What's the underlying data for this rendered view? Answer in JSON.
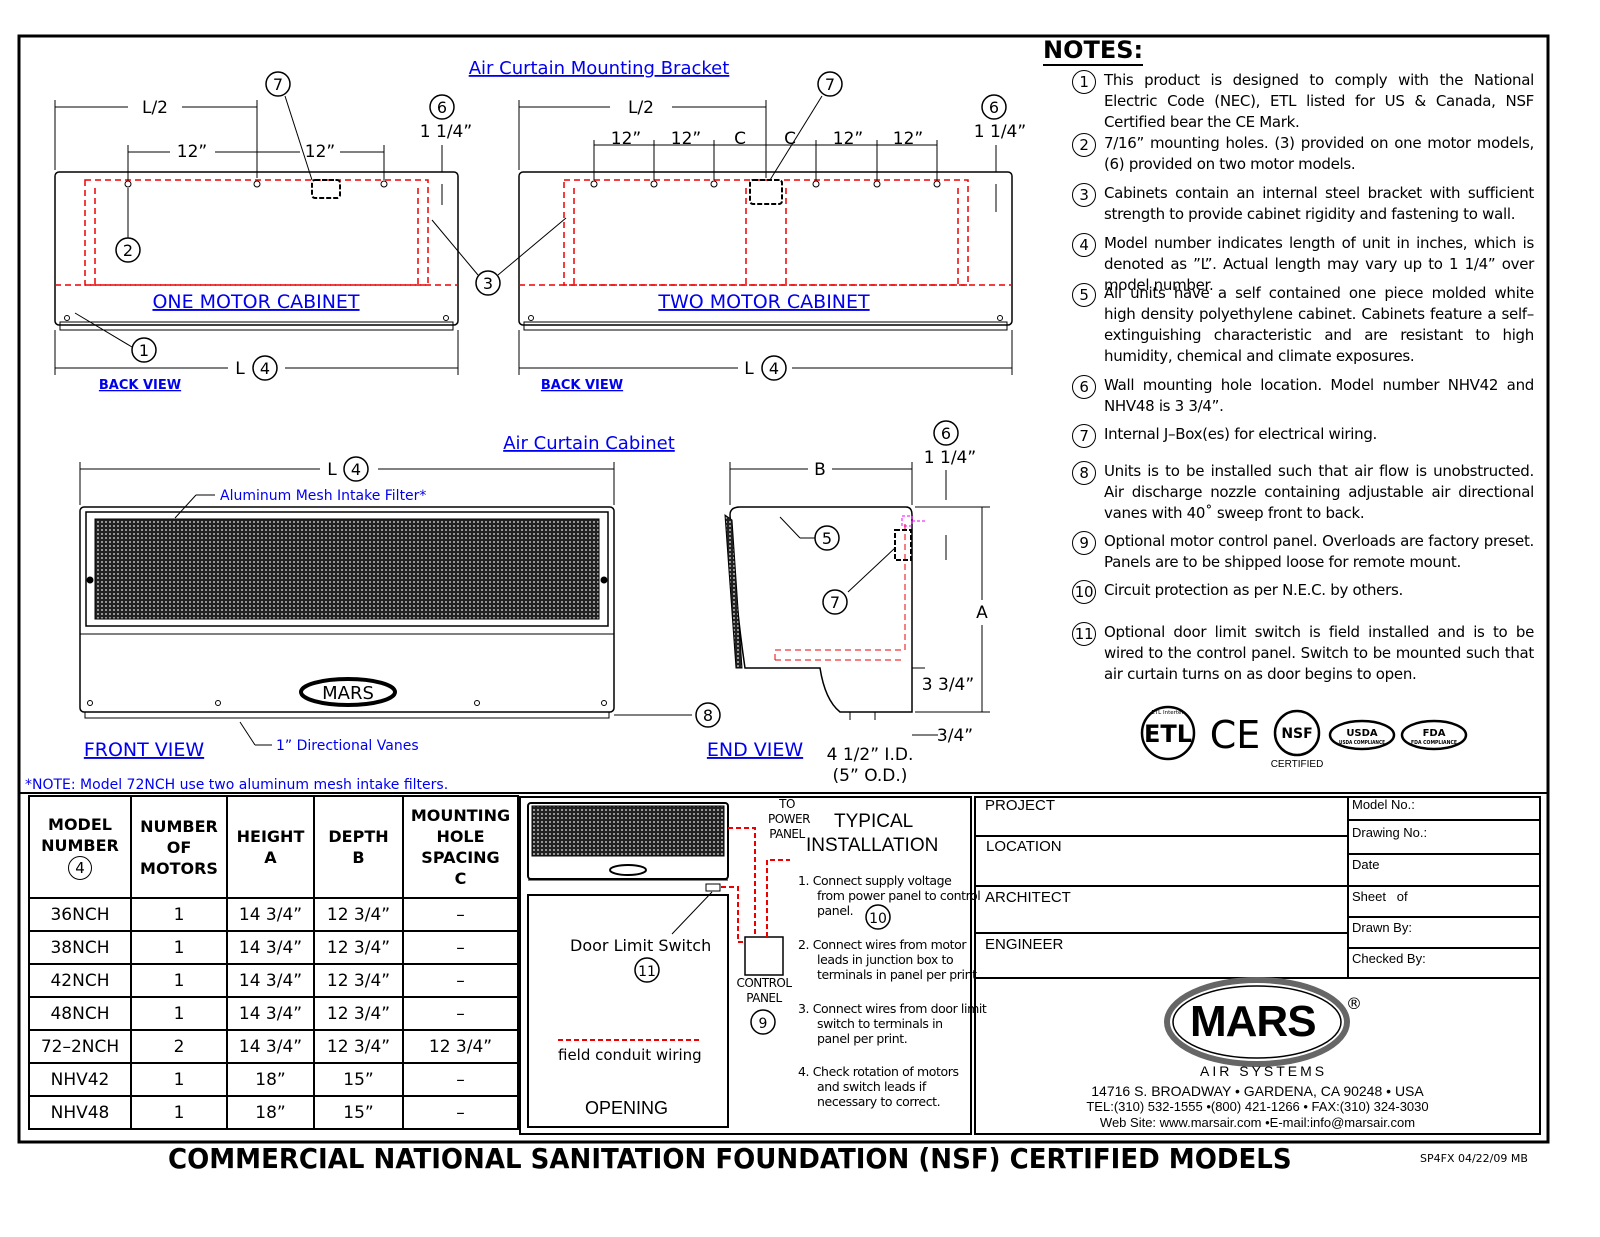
{
  "colors": {
    "accent_blue": "#0000ee",
    "dashed_red": "#ee0000",
    "ink": "#000000"
  },
  "drawings": {
    "bracket_title": "Air Curtain Mounting Bracket",
    "cabinet_title": "Air Curtain Cabinet",
    "one_motor": {
      "label": "ONE MOTOR CABINET",
      "view": "BACK VIEW",
      "half": "L/2",
      "spacing1": "12”",
      "spacing2": "12”",
      "offset": "1 1/4”",
      "length": "L"
    },
    "two_motor": {
      "label": "TWO MOTOR CABINET",
      "view": "BACK VIEW",
      "half": "L/2",
      "s1": "12”",
      "s2": "12”",
      "c1": "C",
      "c2": "C",
      "s3": "12”",
      "s4": "12”",
      "offset": "1 1/4”",
      "length": "L"
    },
    "front": {
      "view": "FRONT VIEW",
      "length": "L",
      "filter": "Aluminum Mesh Intake Filter*",
      "vanes": "1” Directional Vanes",
      "logo": "MARS"
    },
    "end": {
      "view": "END VIEW",
      "depth": "B",
      "height": "A",
      "offset": "1 1/4”",
      "bottom": "3 3/4”",
      "side": "3/4”",
      "id": "4 1/2” I.D.",
      "od": "(5” O.D.)"
    },
    "callouts": [
      "1",
      "2",
      "3",
      "4",
      "5",
      "6",
      "7",
      "8",
      "9",
      "10",
      "11"
    ],
    "footnote": "*NOTE: Model 72NCH use two aluminum mesh intake filters."
  },
  "notes": {
    "title": "NOTES:",
    "items": [
      {
        "n": "1",
        "text": "This product is designed to comply with the National Electric Code (NEC), ETL listed for US & Canada, NSF Certified bear the CE Mark."
      },
      {
        "n": "2",
        "text": "7/16” mounting holes. (3) provided on one motor models, (6) provided on two motor models."
      },
      {
        "n": "3",
        "text": "Cabinets contain an internal steel bracket with sufficient strength to provide cabinet rigidity and fastening to wall."
      },
      {
        "n": "4",
        "text": "Model number indicates length of unit in inches, which is denoted as ”L”. Actual length may vary up to 1 1/4” over model number."
      },
      {
        "n": "5",
        "text": "All units have a self contained one piece molded white high density polyethylene cabinet. Cabinets feature a self–extinguishing characteristic and are resistant to high humidity, chemical and climate exposures."
      },
      {
        "n": "6",
        "text": "Wall mounting hole location. Model number NHV42 and NHV48 is 3 3/4”."
      },
      {
        "n": "7",
        "text": "Internal J–Box(es) for electrical wiring."
      },
      {
        "n": "8",
        "text": "Units is to be installed such that air flow is unobstructed. Air discharge nozzle containing adjustable air directional vanes with 40˚ sweep front to back."
      },
      {
        "n": "9",
        "text": "Optional motor control panel. Overloads are factory preset. Panels are to be shipped loose for remote mount."
      },
      {
        "n": "10",
        "text": "Circuit protection as per N.E.C. by others."
      },
      {
        "n": "11",
        "text": "Optional door limit switch is field installed and is to be wired to the control panel. Switch to be mounted such that air curtain turns on as door begins to open."
      }
    ],
    "certs": [
      "ETL Intertek",
      "CE",
      "NSF",
      "USDA COMPLIANCE",
      "FDA COMPLIANCE"
    ],
    "nsf_caption": "CERTIFIED"
  },
  "table": {
    "headers": [
      {
        "l1": "MODEL",
        "l2": "NUMBER",
        "circ": "4"
      },
      {
        "l1": "NUMBER",
        "l2": "OF",
        "l3": "MOTORS"
      },
      {
        "l1": "HEIGHT",
        "l2": "A"
      },
      {
        "l1": "DEPTH",
        "l2": "B"
      },
      {
        "l1": "MOUNTING",
        "l2": "HOLE",
        "l3": "SPACING",
        "l4": "C"
      }
    ],
    "rows": [
      [
        "36NCH",
        "1",
        "14 3/4”",
        "12 3/4”",
        "–"
      ],
      [
        "38NCH",
        "1",
        "14 3/4”",
        "12 3/4”",
        "–"
      ],
      [
        "42NCH",
        "1",
        "14 3/4”",
        "12 3/4”",
        "–"
      ],
      [
        "48NCH",
        "1",
        "14 3/4”",
        "12 3/4”",
        "–"
      ],
      [
        "72–2NCH",
        "2",
        "14 3/4”",
        "12 3/4”",
        "12 3/4”"
      ],
      [
        "NHV42",
        "1",
        "18”",
        "15”",
        "–"
      ],
      [
        "NHV48",
        "1",
        "18”",
        "15”",
        "–"
      ]
    ]
  },
  "installation": {
    "title1": "TYPICAL",
    "title2": "INSTALLATION",
    "power": [
      "TO",
      "POWER",
      "PANEL"
    ],
    "control": [
      "CONTROL",
      "PANEL"
    ],
    "door_switch": "Door Limit Switch",
    "wiring": "field conduit wiring",
    "opening": "OPENING",
    "steps": [
      {
        "n": "1.",
        "lines": [
          "Connect supply voltage",
          "from power panel to control",
          "panel."
        ]
      },
      {
        "n": "2.",
        "lines": [
          "Connect wires from motor",
          "leads in junction box to",
          "terminals in panel per print."
        ]
      },
      {
        "n": "3.",
        "lines": [
          "Connect wires from door limit",
          "switch to terminals in",
          "panel per print."
        ]
      },
      {
        "n": "4.",
        "lines": [
          "Check rotation of motors",
          "and switch leads if",
          "necessary to correct."
        ]
      }
    ]
  },
  "title_block": {
    "project": "PROJECT",
    "location": "LOCATION",
    "architect": "ARCHITECT",
    "engineer": "ENGINEER",
    "model_no": "Model No.:",
    "drawing_no": "Drawing No.:",
    "date": "Date",
    "sheet": "Sheet   of",
    "drawn_by": "Drawn By:",
    "checked_by": "Checked By:",
    "brand": "MARS",
    "reg": "®",
    "subbrand": "AIR SYSTEMS",
    "address": "14716 S. BROADWAY • GARDENA, CA 90248 • USA",
    "phone": "TEL:(310) 532-1555 •(800) 421-1266 • FAX:(310) 324-3030",
    "web": "Web Site: www.marsair.com •E-mail:info@marsair.com"
  },
  "footer": {
    "title": "COMMERCIAL NATIONAL SANITATION FOUNDATION (NSF) CERTIFIED MODELS",
    "code": "SP4FX 04/22/09 MB"
  }
}
